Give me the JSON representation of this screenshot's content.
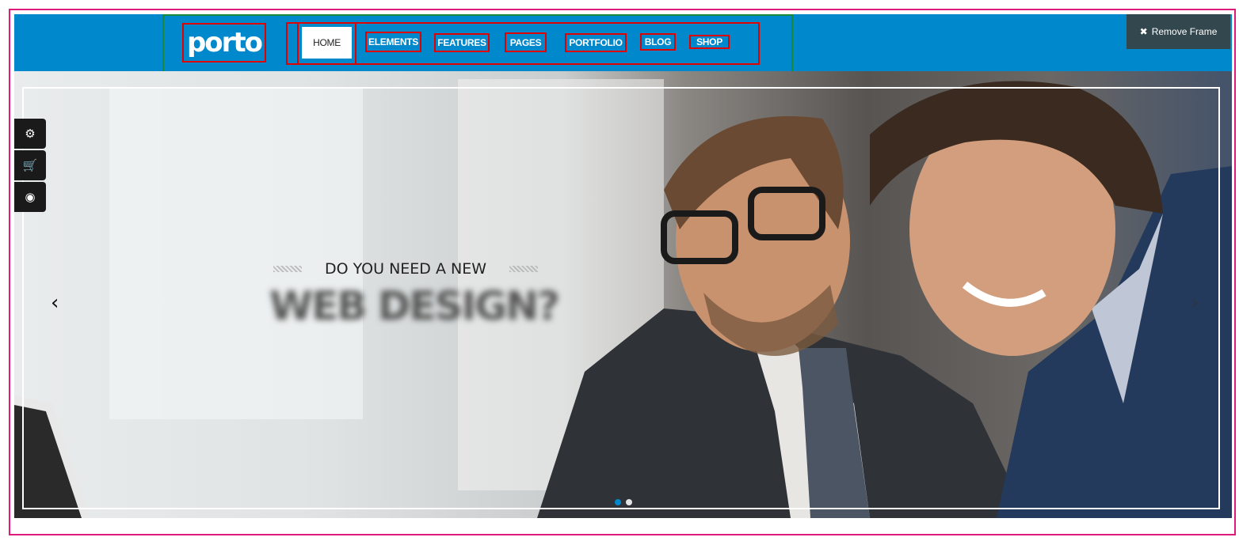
{
  "brand": {
    "logo_text": "porto",
    "colors": {
      "header_bg": "#0088cc",
      "annotation_red": "#e00000",
      "annotation_green": "#1a8a3a",
      "annotation_pink": "#e0197c"
    }
  },
  "nav": {
    "items": [
      {
        "label": "HOME",
        "active": true
      },
      {
        "label": "ELEMENTS"
      },
      {
        "label": "FEATURES"
      },
      {
        "label": "PAGES"
      },
      {
        "label": "PORTFOLIO"
      },
      {
        "label": "BLOG"
      },
      {
        "label": "SHOP"
      }
    ]
  },
  "remove_frame": {
    "icon": "close-icon",
    "label": "Remove Frame"
  },
  "hero": {
    "subtitle": "DO YOU NEED A NEW",
    "title": "WEB DESIGN?",
    "prev_arrow": "‹",
    "next_arrow": "›",
    "slides_total": 2,
    "active_slide": 1
  },
  "side_tools": [
    {
      "icon": "gears-icon",
      "glyph": "⚙"
    },
    {
      "icon": "cart-icon",
      "glyph": "🛒"
    },
    {
      "icon": "target-icon",
      "glyph": "◉"
    }
  ]
}
